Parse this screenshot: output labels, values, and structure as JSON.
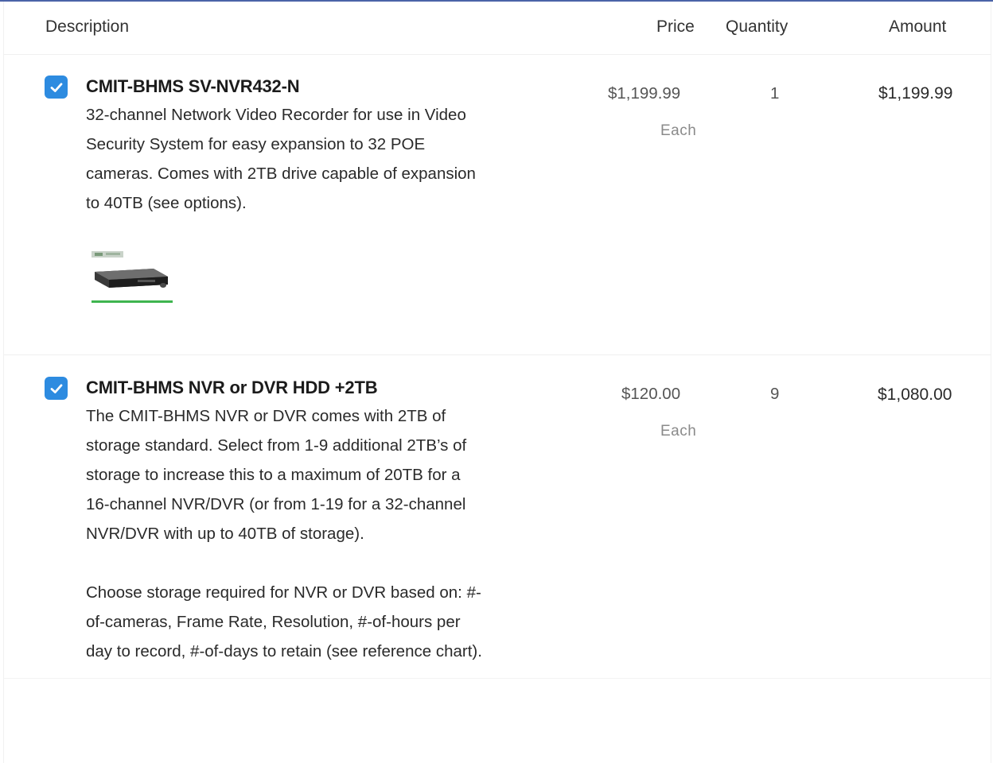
{
  "header": {
    "description": "Description",
    "price": "Price",
    "quantity": "Quantity",
    "amount": "Amount"
  },
  "items": [
    {
      "checked": true,
      "title": "CMIT-BHMS SV-NVR432-N",
      "description_lines": [
        "32-channel Network Video Recorder for use in Video",
        "Security System for easy expansion to 32 POE",
        "cameras. Comes with 2TB drive capable of expansion",
        "to 40TB (see options)."
      ],
      "price": "$1,199.99",
      "unit": "Each",
      "quantity": "1",
      "amount": "$1,199.99",
      "has_image": true
    },
    {
      "checked": true,
      "title": "CMIT-BHMS NVR or DVR HDD +2TB",
      "description_lines": [
        "The CMIT-BHMS NVR or DVR comes with 2TB of",
        "storage standard. Select from 1-9 additional 2TB’s of",
        "storage to increase this to a maximum of 20TB for a",
        "16-channel NVR/DVR (or from 1-19 for a 32-channel",
        "NVR/DVR with up to 40TB of storage)."
      ],
      "description_lines_2": [
        "Choose storage required for NVR or DVR based on: #-",
        "of-cameras, Frame Rate, Resolution, #-of-hours per",
        "day to record, #-of-days to retain (see reference chart)."
      ],
      "price": "$120.00",
      "unit": "Each",
      "quantity": "9",
      "amount": "$1,080.00"
    }
  ],
  "colors": {
    "checkbox": "#2d8be0",
    "top_rule": "#4b63a8"
  },
  "icons": {
    "checkbox": "checkmark-icon"
  }
}
